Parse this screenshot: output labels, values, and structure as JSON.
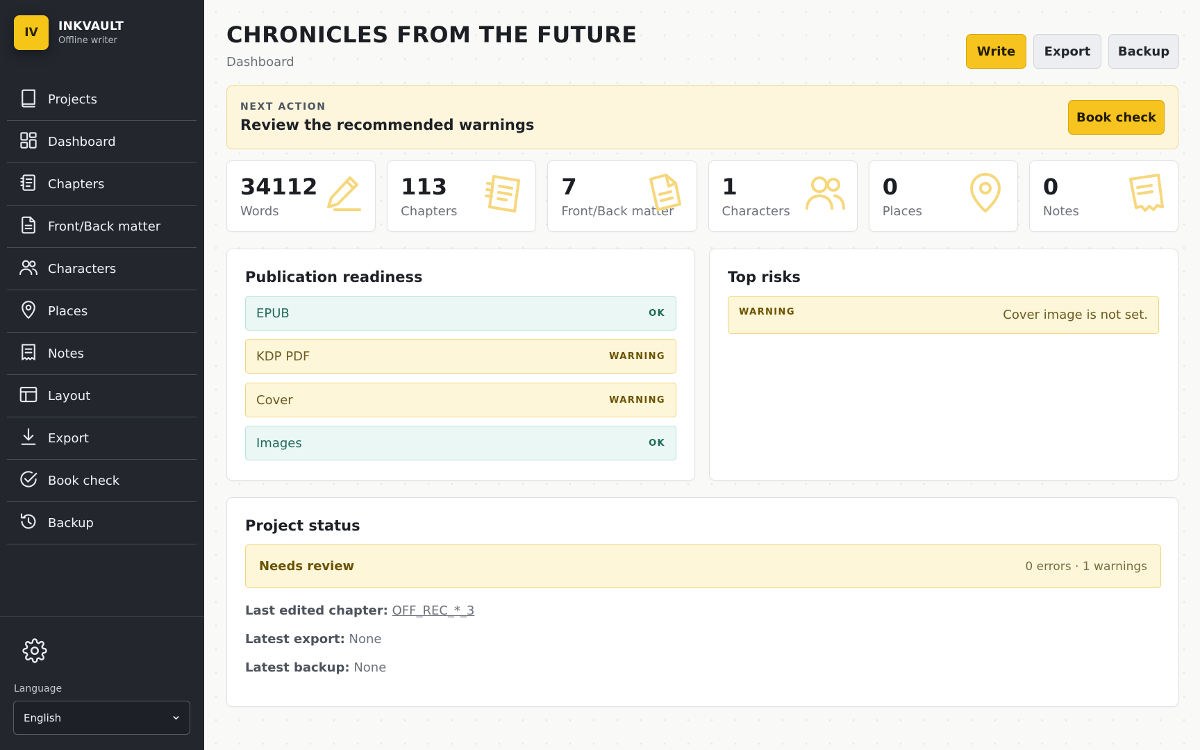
{
  "app": {
    "logo_initials": "IV",
    "name": "INKVAULT",
    "subtitle": "Offline writer",
    "accent_color": "#f7c41f"
  },
  "sidebar": {
    "items": [
      {
        "label": "Projects",
        "icon": "book-icon"
      },
      {
        "label": "Dashboard",
        "icon": "dashboard-grid-icon"
      },
      {
        "label": "Chapters",
        "icon": "chapters-list-icon"
      },
      {
        "label": "Front/Back matter",
        "icon": "document-icon"
      },
      {
        "label": "Characters",
        "icon": "users-icon"
      },
      {
        "label": "Places",
        "icon": "map-pin-icon"
      },
      {
        "label": "Notes",
        "icon": "notes-icon"
      },
      {
        "label": "Layout",
        "icon": "layout-icon"
      },
      {
        "label": "Export",
        "icon": "download-icon"
      },
      {
        "label": "Book check",
        "icon": "check-circle-icon"
      },
      {
        "label": "Backup",
        "icon": "history-icon"
      }
    ],
    "settings_icon": "gear-icon",
    "language_label": "Language",
    "language_value": "English"
  },
  "header": {
    "title": "CHRONICLES FROM THE FUTURE",
    "subtitle": "Dashboard",
    "actions": {
      "write": "Write",
      "export": "Export",
      "backup": "Backup"
    }
  },
  "next_action": {
    "kicker": "NEXT ACTION",
    "title": "Review the recommended warnings",
    "button": "Book check"
  },
  "stats": [
    {
      "value": "34112",
      "label": "Words",
      "icon": "pencil-icon"
    },
    {
      "value": "113",
      "label": "Chapters",
      "icon": "notebook-icon"
    },
    {
      "value": "7",
      "label": "Front/Back matter",
      "icon": "document-icon"
    },
    {
      "value": "1",
      "label": "Characters",
      "icon": "users-icon"
    },
    {
      "value": "0",
      "label": "Places",
      "icon": "map-pin-icon"
    },
    {
      "value": "0",
      "label": "Notes",
      "icon": "receipt-icon"
    }
  ],
  "readiness": {
    "title": "Publication readiness",
    "rows": [
      {
        "name": "EPUB",
        "status": "OK"
      },
      {
        "name": "KDP PDF",
        "status": "WARNING"
      },
      {
        "name": "Cover",
        "status": "WARNING"
      },
      {
        "name": "Images",
        "status": "OK"
      }
    ]
  },
  "risks": {
    "title": "Top risks",
    "items": [
      {
        "level": "WARNING",
        "text": "Cover image is not set."
      }
    ]
  },
  "project_status": {
    "title": "Project status",
    "status": "Needs review",
    "counts": "0 errors · 1 warnings",
    "last_edited_label": "Last edited chapter:",
    "last_edited_value": "OFF_REC_*_3",
    "latest_export_label": "Latest export:",
    "latest_export_value": "None",
    "latest_backup_label": "Latest backup:",
    "latest_backup_value": "None"
  }
}
